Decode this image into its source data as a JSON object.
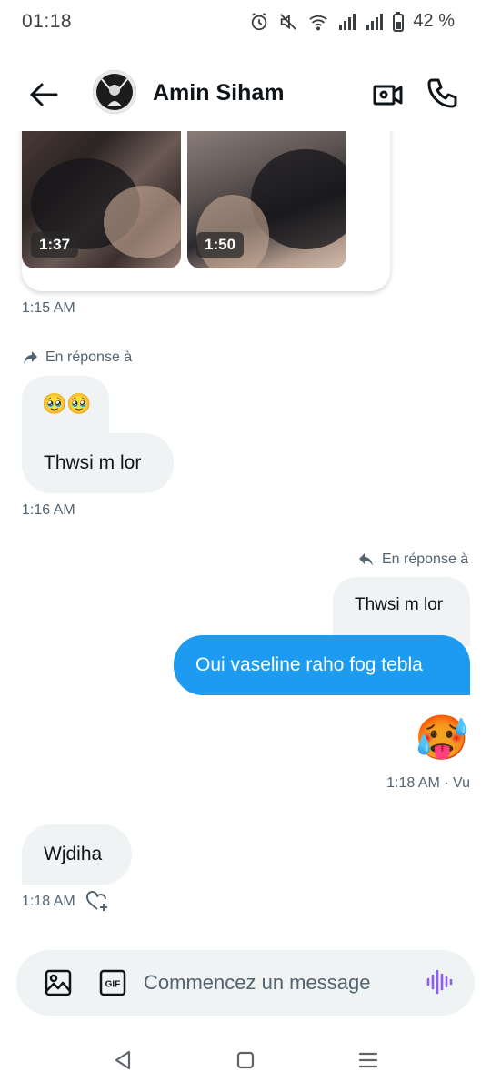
{
  "status_bar": {
    "time": "01:18",
    "battery_percent": "42 %",
    "icons": [
      "alarm-icon",
      "mute-icon",
      "wifi-icon",
      "signal-icon",
      "signal-icon",
      "battery-icon"
    ]
  },
  "header": {
    "contact_name": "Amin Siham",
    "icons": [
      "back-arrow-icon",
      "video-call-icon",
      "phone-icon"
    ]
  },
  "messages": {
    "media": {
      "videos": [
        {
          "duration": "1:37"
        },
        {
          "duration": "1:50"
        }
      ],
      "timestamp": "1:15 AM"
    },
    "incoming_reply": {
      "reply_label": "En réponse à",
      "quoted_emoji": "🥹🥹",
      "text": "Thwsi m lor",
      "timestamp": "1:16 AM"
    },
    "outgoing_reply": {
      "reply_label": "En réponse à",
      "quoted_text": "Thwsi m lor",
      "text": "Oui vaseline raho fog tebla",
      "emoji": "🥵",
      "timestamp": "1:18 AM · Vu"
    },
    "incoming_last": {
      "text": "Wjdiha",
      "timestamp": "1:18 AM"
    }
  },
  "composer": {
    "placeholder": "Commencez un message",
    "icons": [
      "image-icon",
      "gif-icon",
      "voice-message-icon"
    ],
    "gif_label": "GIF"
  },
  "colors": {
    "accent": "#1d9bf0",
    "bubble_in": "#eff3f4",
    "muted_text": "#536471",
    "voice_icon": "#8b5cf6"
  }
}
